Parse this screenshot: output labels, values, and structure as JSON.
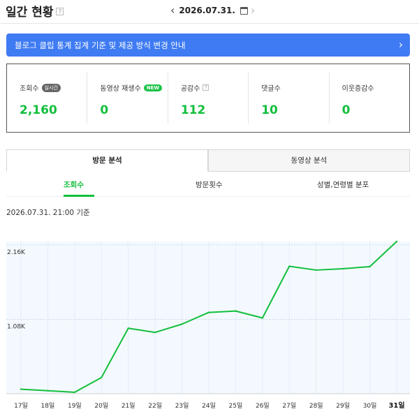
{
  "header": {
    "title": "일간 현황",
    "help": "?",
    "date": "2026.07.31."
  },
  "banner": {
    "text": "블로그 클립 통계 집계 기준 및 제공 방식 변경 안내"
  },
  "stats": [
    {
      "label": "조회수",
      "badge": "실시간",
      "value": "2,160"
    },
    {
      "label": "동영상 재생수",
      "badge": "NEW",
      "value": "0"
    },
    {
      "label": "공감수",
      "help": "?",
      "value": "112"
    },
    {
      "label": "댓글수",
      "value": "10"
    },
    {
      "label": "이웃증감수",
      "value": "0"
    }
  ],
  "tabs": [
    "방문 분석",
    "동영상 분석"
  ],
  "subtabs": [
    "조회수",
    "방문횟수",
    "성별,연령별 분포"
  ],
  "basis": "2026.07.31. 21:00 기준",
  "colors": {
    "accent_green": "#12bf3c",
    "banner_blue": "#3f7bf2"
  },
  "chart_data": {
    "type": "area",
    "categories": [
      "17일",
      "18일",
      "19일",
      "20일",
      "21일",
      "22일",
      "23일",
      "24일",
      "25일",
      "26일",
      "27일",
      "28일",
      "29일",
      "30일",
      "31일"
    ],
    "values": [
      130,
      85,
      40,
      470,
      1900,
      1780,
      2020,
      2360,
      2400,
      2200,
      3700,
      3590,
      3630,
      3690,
      4420
    ],
    "ytick_values": [
      2160,
      4320
    ],
    "ytick_labels": [
      "1.08K",
      "2.16K"
    ],
    "ylim": [
      0,
      4420
    ],
    "highlight_category": "31일",
    "grid": true,
    "title": "",
    "xlabel": "",
    "ylabel": ""
  }
}
